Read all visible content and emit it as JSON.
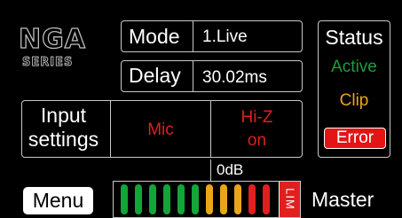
{
  "logo": {
    "brand": "NGA",
    "series": "SERIES"
  },
  "mode": {
    "label": "Mode",
    "value": "1.Live"
  },
  "delay": {
    "label": "Delay",
    "value": "30.02ms"
  },
  "input_settings": {
    "label_line1": "Input",
    "label_line2": "settings",
    "mic_label": "Mic",
    "hiz_line1": "Hi-Z",
    "hiz_line2": "on"
  },
  "status": {
    "title": "Status",
    "active": "Active",
    "clip": "Clip",
    "error": "Error"
  },
  "meter": {
    "zero_db_label": "0dB",
    "limiter_label": "LIM",
    "channel_label": "Master",
    "segment_colors": [
      "#13a53a",
      "#13a53a",
      "#13a53a",
      "#13a53a",
      "#13a53a",
      "#13a53a",
      "#e9a51c",
      "#e9a51c",
      "#e9a51c",
      "#e01f1f",
      "#e01f1f"
    ]
  },
  "menu": {
    "label": "Menu"
  },
  "colors": {
    "background": "#000000",
    "frame": "#c8c8c8",
    "green": "#13a53a",
    "orange": "#e9a51c",
    "red": "#e01f1f"
  }
}
